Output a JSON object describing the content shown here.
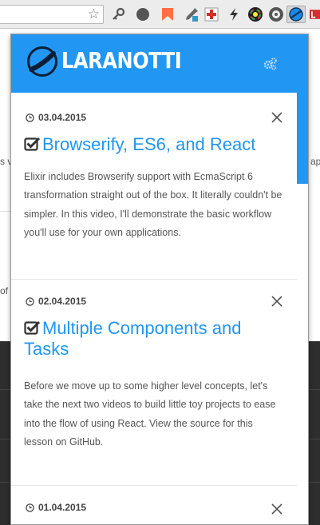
{
  "browser": {
    "extensions": [
      "key-icon",
      "circle-icon",
      "bookmark-icon",
      "dropper-icon",
      "puzzle-cross-icon",
      "bolt-icon",
      "color-wheel-icon",
      "laranotti-icon",
      "red-ext-icon"
    ]
  },
  "background": {
    "left_fragments": [
      "s v",
      "of"
    ],
    "right_fragments": [
      "ap"
    ]
  },
  "popup": {
    "brand": "LARANOTTI",
    "accent": "#2196f3",
    "items": [
      {
        "date": "03.04.2015",
        "title": "Browserify, ES6, and React",
        "description": "Elixir includes Browserify support with EcmaScript 6 transformation straight out of the box. It literally couldn't be simpler. In this video, I'll demonstrate the basic workflow you'll use for your own applications."
      },
      {
        "date": "02.04.2015",
        "title": "Multiple Components and Tasks",
        "description": "Before we move up to some higher level concepts, let's take the next two videos to build little toy projects to ease into the flow of using React. View the source for this lesson on GitHub."
      },
      {
        "date": "01.04.2015",
        "title": "",
        "description": ""
      }
    ]
  }
}
